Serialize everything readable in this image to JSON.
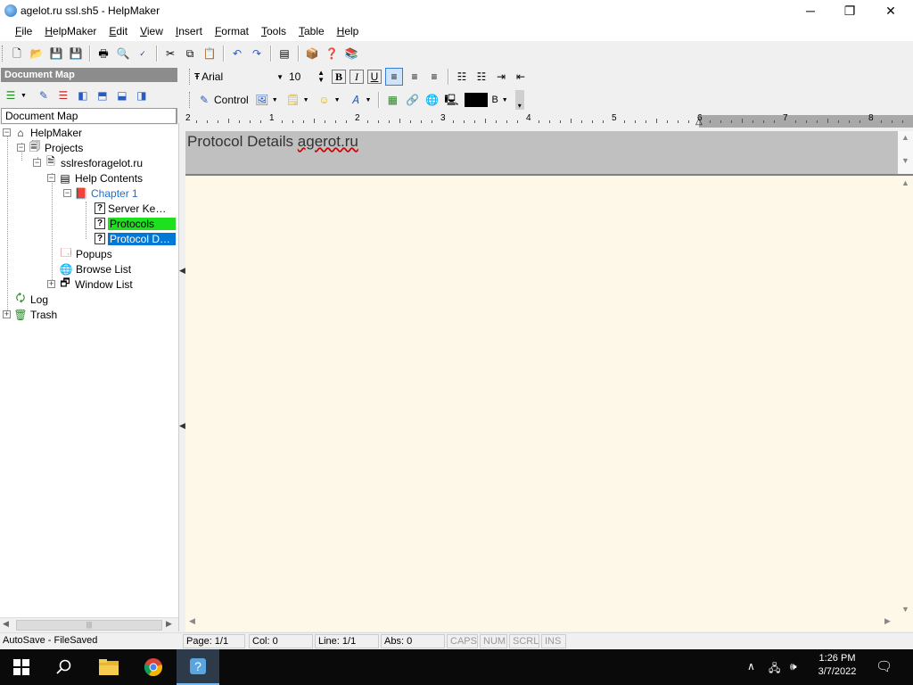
{
  "window": {
    "title": "agelot.ru ssl.sh5 - HelpMaker",
    "controls": [
      "─",
      "❐",
      "✕"
    ]
  },
  "menu": [
    {
      "first": "F",
      "rest": "ile"
    },
    {
      "first": "H",
      "rest": "elpMaker"
    },
    {
      "first": "E",
      "rest": "dit"
    },
    {
      "first": "V",
      "rest": "iew"
    },
    {
      "first": "I",
      "rest": "nsert"
    },
    {
      "first": "F",
      "rest": "ormat"
    },
    {
      "first": "T",
      "rest": "ools"
    },
    {
      "first": "T",
      "rest": "able"
    },
    {
      "first": "H",
      "rest": "elp"
    }
  ],
  "format_toolbar": {
    "font": "Arial",
    "size": "10",
    "control_label": "Control",
    "color_label": "B",
    "text_color": "#000000"
  },
  "doc_map": {
    "header": "Document Map",
    "label": "Document Map",
    "tree": {
      "helpmaker": "HelpMaker",
      "projects": "Projects",
      "project": "sslresforagelot.ru",
      "help_contents": "Help Contents",
      "chapter": "Chapter 1",
      "topic1": "Server Ke…",
      "topic2": "Protocols",
      "topic3": "Protocol D…",
      "popups": "Popups",
      "browse": "Browse List",
      "window": "Window List",
      "log": "Log",
      "trash": "Trash"
    }
  },
  "ruler": {
    "marks": [
      "2",
      "1",
      "2",
      "3",
      "4",
      "5",
      "6",
      "7",
      "8"
    ]
  },
  "topic": {
    "title_pre": "Protocol Details ",
    "title_misspelled": "agerot.ru"
  },
  "status": {
    "autosave": "AutoSave - FileSaved",
    "page": "Page: 1/1",
    "col": "Col: 0",
    "line": "Line: 1/1",
    "abs": "Abs: 0",
    "caps": "CAPS",
    "num": "NUM",
    "scrl": "SCRL",
    "ins": "INS"
  },
  "taskbar": {
    "time": "1:26 PM",
    "date": "3/7/2022"
  },
  "colors": {
    "selection_blue": "#0078d7",
    "selection_green": "#1ee01e",
    "chapter_link": "#1a6fd1",
    "editor_bg": "#fdf8e8"
  }
}
